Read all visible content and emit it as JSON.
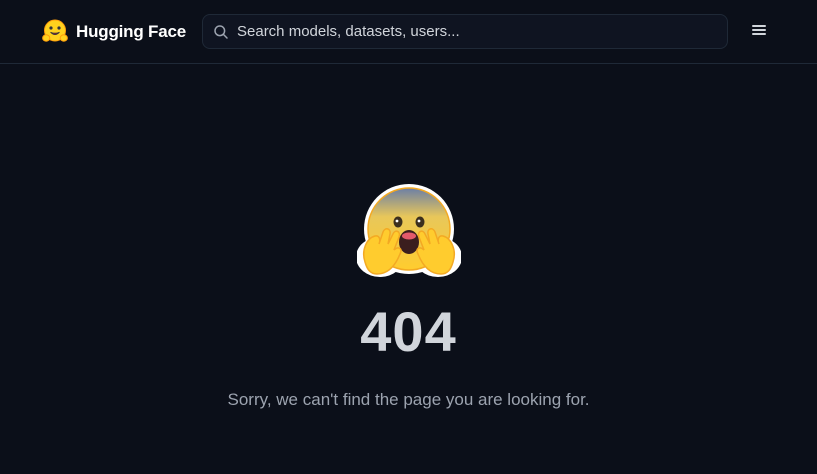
{
  "header": {
    "logo_text": "Hugging Face",
    "logo_icon": "hugging-face-emoji",
    "search": {
      "placeholder": "Search models, datasets, users...",
      "value": "",
      "icon": "search-icon"
    },
    "menu_icon": "hamburger-menu-icon"
  },
  "main": {
    "illustration_icon": "face-screaming-with-hands-emoji",
    "error_code": "404",
    "message": "Sorry, we can't find the page you are looking for."
  },
  "colors": {
    "background": "#0b0f19",
    "border": "#1f2937",
    "heading": "#d1d5db",
    "muted_text": "#9ca3af",
    "emoji_yellow": "#ffd21e",
    "emoji_orange": "#ff9d0b"
  }
}
